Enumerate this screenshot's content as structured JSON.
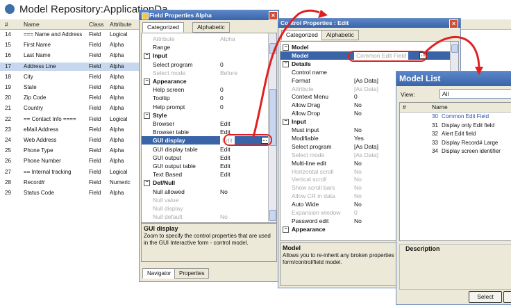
{
  "repo": {
    "title": "Model Repository:ApplicationDa",
    "columns": [
      "#",
      "Name",
      "Class",
      "Attribute"
    ],
    "rows": [
      {
        "num": "14",
        "name": "=== Name and Address",
        "cls": "Field",
        "attr": "Logical"
      },
      {
        "num": "15",
        "name": "First Name",
        "cls": "Field",
        "attr": "Alpha"
      },
      {
        "num": "16",
        "name": "Last Name",
        "cls": "Field",
        "attr": "Alpha"
      },
      {
        "num": "17",
        "name": "Address Line",
        "cls": "Field",
        "attr": "Alpha"
      },
      {
        "num": "18",
        "name": "City",
        "cls": "Field",
        "attr": "Alpha"
      },
      {
        "num": "19",
        "name": "State",
        "cls": "Field",
        "attr": "Alpha"
      },
      {
        "num": "20",
        "name": "Zip Code",
        "cls": "Field",
        "attr": "Alpha"
      },
      {
        "num": "21",
        "name": "Country",
        "cls": "Field",
        "attr": "Alpha"
      },
      {
        "num": "22",
        "name": "== Contact Info ====",
        "cls": "Field",
        "attr": "Logical"
      },
      {
        "num": "23",
        "name": "eMail Address",
        "cls": "Field",
        "attr": "Alpha"
      },
      {
        "num": "24",
        "name": "Web Address",
        "cls": "Field",
        "attr": "Alpha"
      },
      {
        "num": "25",
        "name": "Phone Type",
        "cls": "Field",
        "attr": "Alpha"
      },
      {
        "num": "26",
        "name": "Phone Number",
        "cls": "Field",
        "attr": "Alpha"
      },
      {
        "num": "27",
        "name": "== Internal tracking",
        "cls": "Field",
        "attr": "Logical"
      },
      {
        "num": "28",
        "name": "Record#",
        "cls": "Field",
        "attr": "Numeric"
      },
      {
        "num": "29",
        "name": "Status Code",
        "cls": "Field",
        "attr": "Alpha"
      }
    ]
  },
  "field_props": {
    "title": "Field Properties Alpha",
    "tabs": [
      "Categorized",
      "Alphabetic"
    ],
    "rows": [
      {
        "kind": "prop",
        "name": "Attribute",
        "value": "Alpha",
        "grey": true
      },
      {
        "kind": "prop",
        "name": "Range",
        "value": "",
        "grey": false
      },
      {
        "kind": "cat",
        "name": "Input"
      },
      {
        "kind": "prop",
        "name": "Select program",
        "value": "0",
        "grey": false
      },
      {
        "kind": "prop",
        "name": "Select mode",
        "value": "Before",
        "grey": true
      },
      {
        "kind": "cat",
        "name": "Appearance"
      },
      {
        "kind": "prop",
        "name": "Help screen",
        "value": "0",
        "grey": false
      },
      {
        "kind": "prop",
        "name": "Tooltip",
        "value": "0",
        "grey": false
      },
      {
        "kind": "prop",
        "name": "Help prompt",
        "value": "0",
        "grey": false
      },
      {
        "kind": "cat",
        "name": "Style"
      },
      {
        "kind": "prop",
        "name": "Browser",
        "value": "Edit",
        "grey": false
      },
      {
        "kind": "prop",
        "name": "Browser table",
        "value": "Edit",
        "grey": false
      },
      {
        "kind": "sel",
        "name": "GUI display",
        "value": "Edit",
        "grey": true
      },
      {
        "kind": "prop",
        "name": "GUI display table",
        "value": "Edit",
        "grey": false
      },
      {
        "kind": "prop",
        "name": "GUI output",
        "value": "Edit",
        "grey": false
      },
      {
        "kind": "prop",
        "name": "GUI output table",
        "value": "Edit",
        "grey": false
      },
      {
        "kind": "prop",
        "name": "Text Based",
        "value": "Edit",
        "grey": false
      },
      {
        "kind": "cat",
        "name": "Def/Null"
      },
      {
        "kind": "prop",
        "name": "Null allowed",
        "value": "No",
        "grey": false
      },
      {
        "kind": "prop",
        "name": "Null value",
        "value": "",
        "grey": true
      },
      {
        "kind": "prop",
        "name": "Null display",
        "value": "",
        "grey": true
      },
      {
        "kind": "prop",
        "name": "Null default",
        "value": "No",
        "grey": true
      }
    ],
    "desc_title": "GUI display",
    "desc_text": "Zoom to specify the control properties that are used in the GUI Interactive form - control model.",
    "bottom_tabs": [
      "Navigator",
      "Properties"
    ]
  },
  "control_props": {
    "title": "Control Properties : Edit",
    "tabs": [
      "Categorized",
      "Alphabetic"
    ],
    "rows": [
      {
        "kind": "cat",
        "name": "Model"
      },
      {
        "kind": "sel",
        "name": "Model",
        "value": "Common Edit Field",
        "grey": true
      },
      {
        "kind": "cat",
        "name": "Details"
      },
      {
        "kind": "prop",
        "name": "Control name",
        "value": "",
        "grey": false
      },
      {
        "kind": "prop",
        "name": "Format",
        "value": "[As Data]",
        "grey": false
      },
      {
        "kind": "prop",
        "name": "Attribute",
        "value": "[As Data]",
        "grey": true
      },
      {
        "kind": "prop",
        "name": "Context Menu",
        "value": "0",
        "grey": false
      },
      {
        "kind": "prop",
        "name": "Allow Drag",
        "value": "No",
        "grey": false
      },
      {
        "kind": "prop",
        "name": "Allow Drop",
        "value": "No",
        "grey": false
      },
      {
        "kind": "cat",
        "name": "Input"
      },
      {
        "kind": "prop",
        "name": "Must input",
        "value": "No",
        "grey": false
      },
      {
        "kind": "prop",
        "name": "Modifiable",
        "value": "Yes",
        "grey": false
      },
      {
        "kind": "prop",
        "name": "Select program",
        "value": "[As Data]",
        "grey": false
      },
      {
        "kind": "prop",
        "name": "Select mode",
        "value": "[As Data]",
        "grey": true
      },
      {
        "kind": "prop",
        "name": "Multi-line edit",
        "value": "No",
        "grey": false
      },
      {
        "kind": "prop",
        "name": "Horizontal scroll",
        "value": "No",
        "grey": true
      },
      {
        "kind": "prop",
        "name": "Vertical scroll",
        "value": "No",
        "grey": true
      },
      {
        "kind": "prop",
        "name": "Show scroll bars",
        "value": "No",
        "grey": true
      },
      {
        "kind": "prop",
        "name": "Allow CR in data",
        "value": "No",
        "grey": true
      },
      {
        "kind": "prop",
        "name": "Auto Wide",
        "value": "No",
        "grey": false
      },
      {
        "kind": "prop",
        "name": "Expansion window",
        "value": "0",
        "grey": true
      },
      {
        "kind": "prop",
        "name": "Password edit",
        "value": "No",
        "grey": false
      },
      {
        "kind": "cat",
        "name": "Appearance"
      }
    ],
    "desc_title": "Model",
    "desc_text": "Allows you to re-inherit any broken properties of the model for the form/control/field model."
  },
  "model_list": {
    "title": "Model List",
    "view_label": "View:",
    "view_value": "All",
    "columns": [
      "#",
      "Name"
    ],
    "rows": [
      {
        "num": "30",
        "name": "Common Edit Field"
      },
      {
        "num": "31",
        "name": "Display only Edit field"
      },
      {
        "num": "32",
        "name": "Alert Edit field"
      },
      {
        "num": "33",
        "name": "Display Record# Large"
      },
      {
        "num": "34",
        "name": "Display screen identifier"
      }
    ],
    "desc_label": "Description",
    "select_label": "Select"
  },
  "colors": {
    "accent": "#3a64a8",
    "highlight": "#e02020",
    "selection": "#c7d7ee"
  }
}
